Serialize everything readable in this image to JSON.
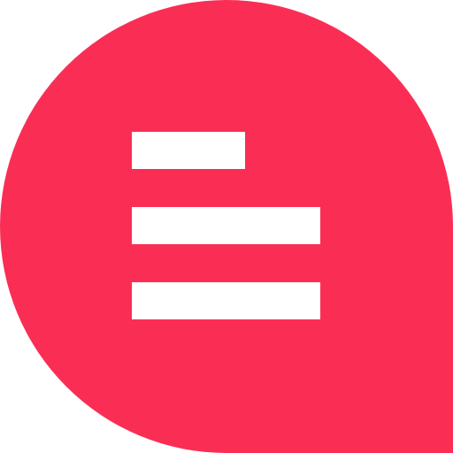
{
  "icon": {
    "name": "chat-bubble-icon",
    "glyph": "text-lines",
    "line_count": 3
  },
  "colors": {
    "background": "#ffffff",
    "bubble": "#fa2e55",
    "lines": "#ffffff"
  }
}
